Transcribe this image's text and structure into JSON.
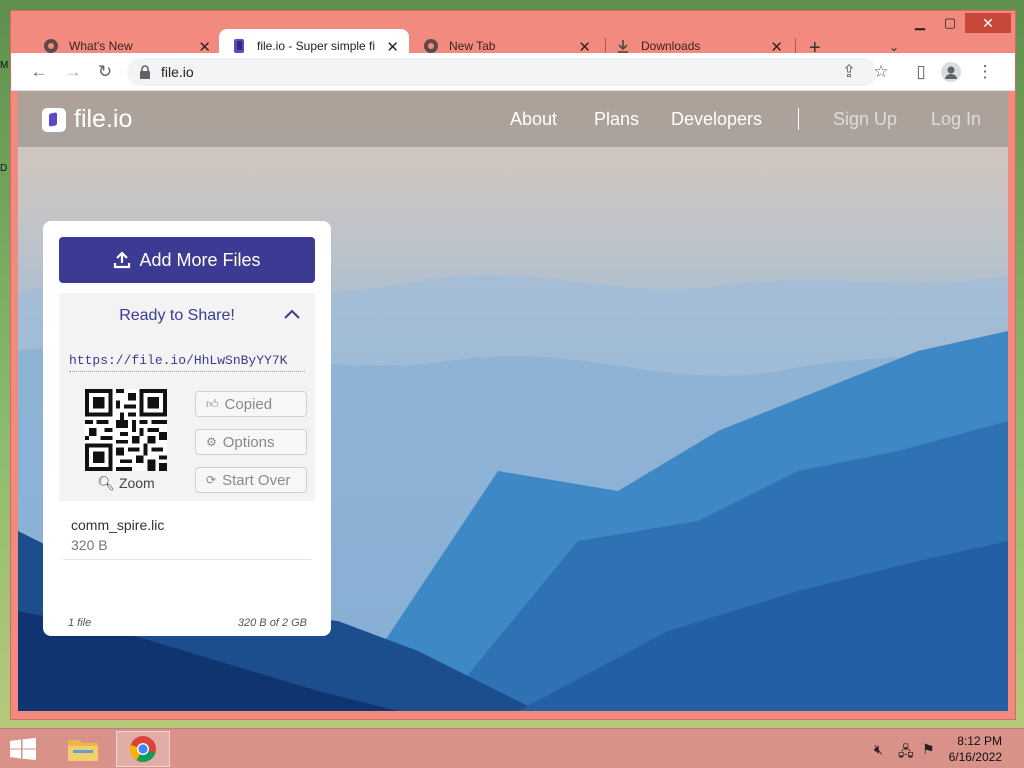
{
  "desktop": {
    "fragments": [
      "M",
      "D"
    ]
  },
  "window": {
    "controls": {
      "minimize": "▁",
      "maximize": "▢",
      "close": "✕"
    },
    "tabs": [
      {
        "title": "What's New",
        "icon": "chrome-icon",
        "close": "✕"
      },
      {
        "title": "file.io - Super simple file",
        "icon": "fileio-icon",
        "close": "✕"
      },
      {
        "title": "New Tab",
        "icon": "chrome-icon",
        "close": "✕"
      },
      {
        "title": "Downloads",
        "icon": "download-icon",
        "close": "✕"
      }
    ],
    "new_tab": "+",
    "tab_search": "⌄",
    "toolbar": {
      "back": "←",
      "forward": "→",
      "reload": "↻",
      "url": "file.io",
      "share": "⇪",
      "bookmark": "☆",
      "sidepanel": "▯",
      "menu": "⋮"
    }
  },
  "site": {
    "brand": "file.io",
    "nav": [
      "About",
      "Plans",
      "Developers"
    ],
    "divider": "|",
    "signup": "Sign Up",
    "login": "Log In",
    "add_button": "Add More Files",
    "ready_title": "Ready to Share!",
    "share_link": "https://file.io/HhLwSnByYY7K",
    "zoom": "Zoom",
    "actions": {
      "copied": "Copied",
      "options": "Options",
      "start_over": "Start Over"
    },
    "file_name": "comm_spire.lic",
    "file_size": "320 B",
    "file_count": "1 file",
    "quota": "320 B of 2 GB"
  },
  "taskbar": {
    "time": "8:12 PM",
    "date": "6/16/2022"
  },
  "colors": {
    "accent": "#3c3b94",
    "window_frame": "#f28a7f",
    "close_red": "#c7483a"
  }
}
